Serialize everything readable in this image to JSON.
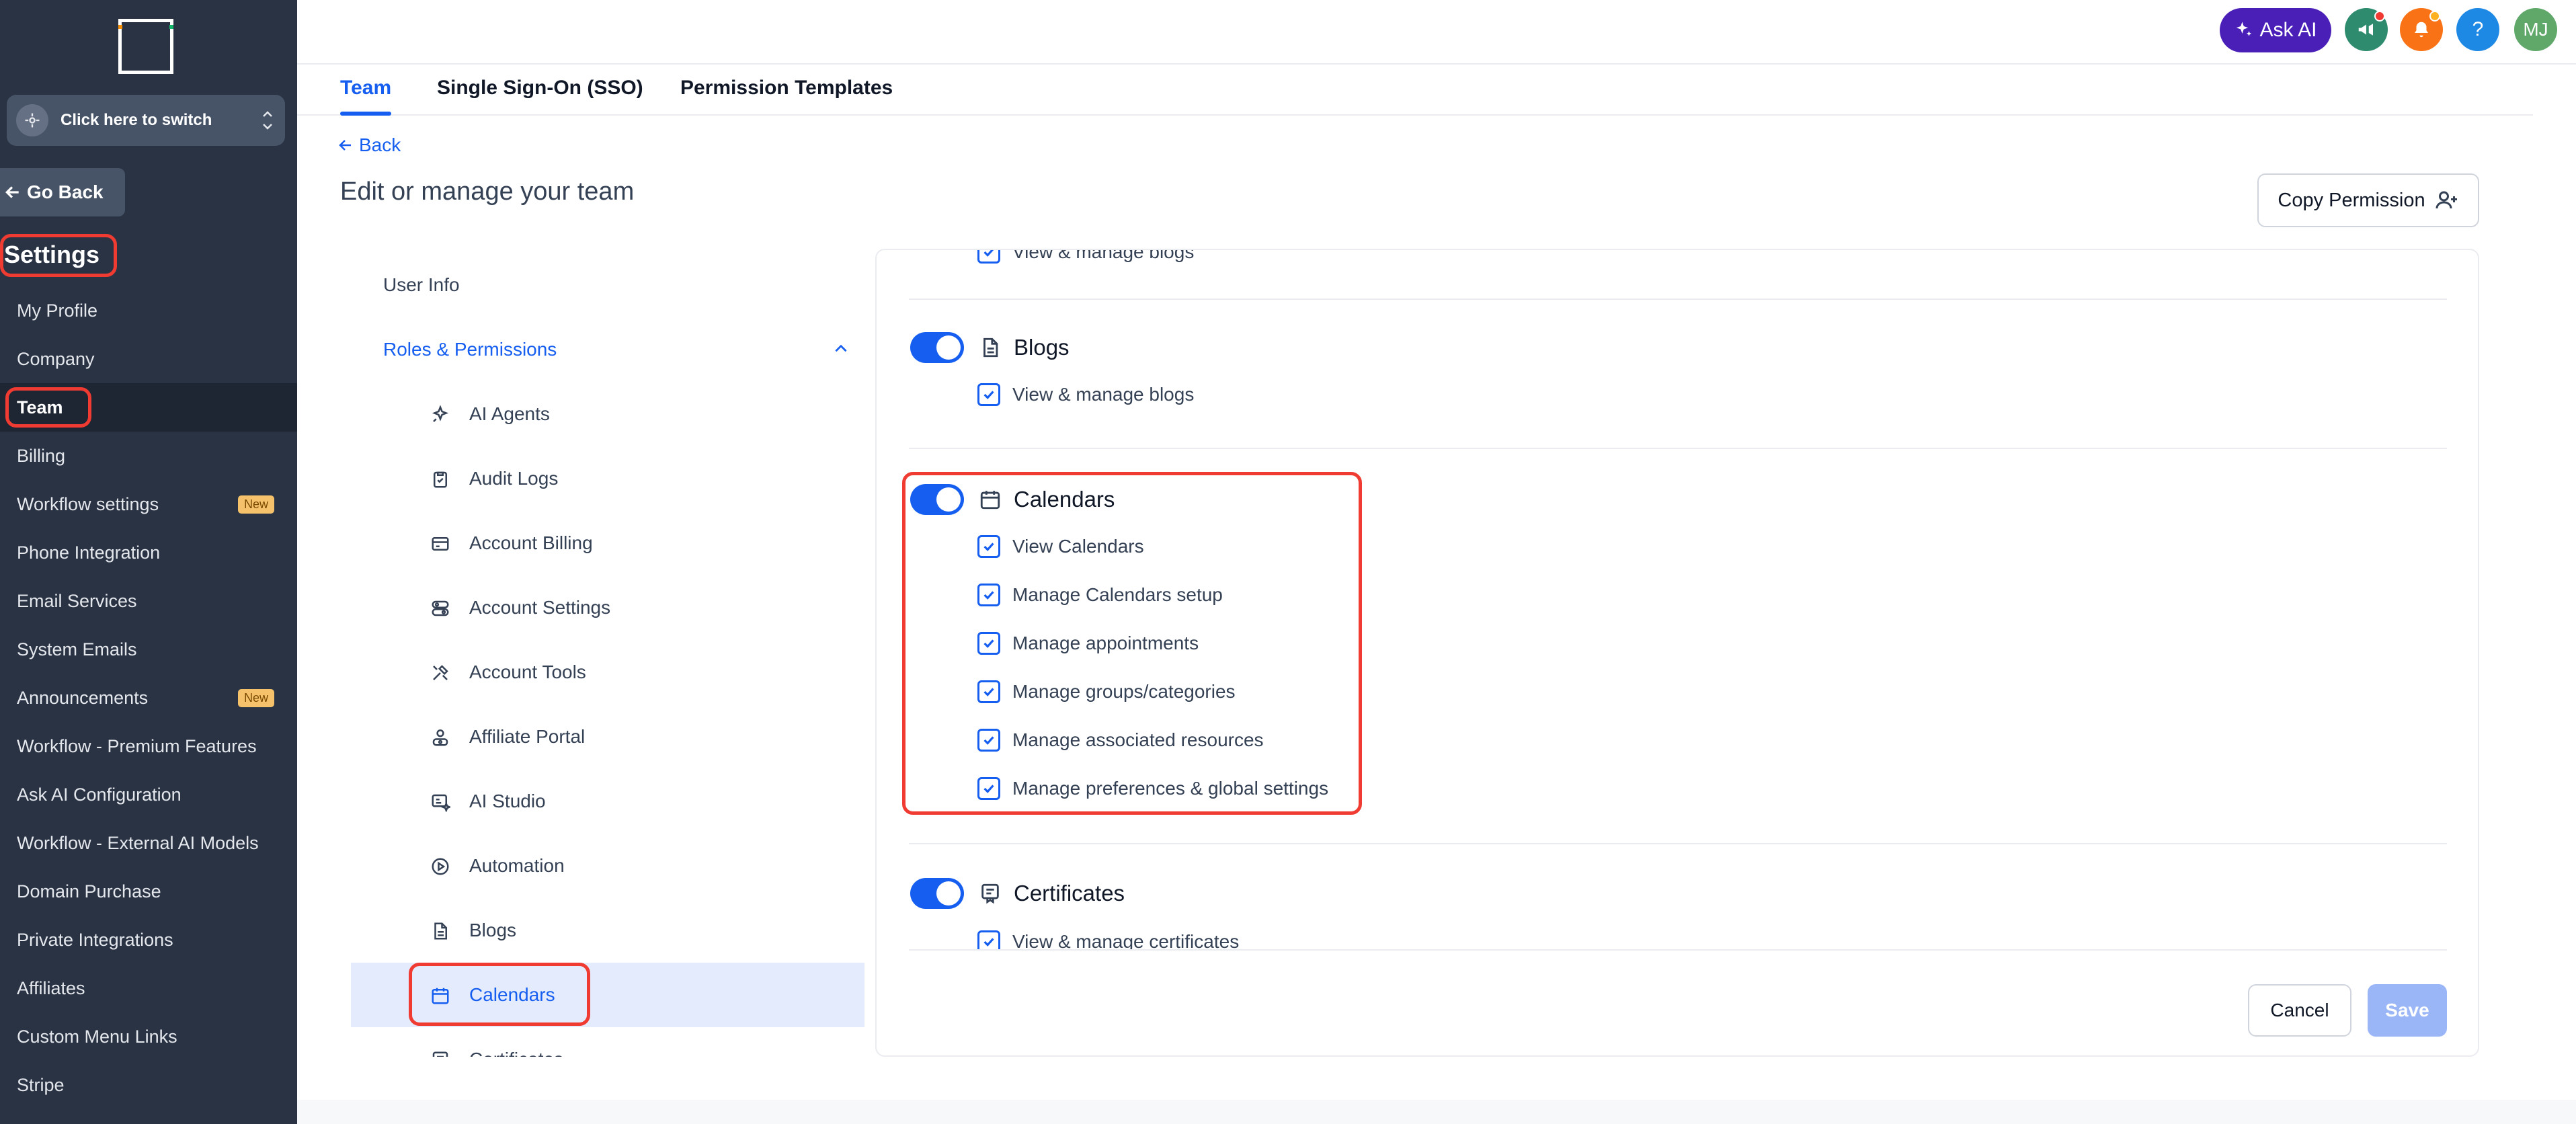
{
  "sidebar": {
    "switcher_label": "Click here to switch",
    "go_back": "Go Back",
    "title": "Settings",
    "items": [
      {
        "label": "My Profile"
      },
      {
        "label": "Company"
      },
      {
        "label": "Team",
        "active": true
      },
      {
        "label": "Billing"
      },
      {
        "label": "Workflow settings",
        "badge": "New"
      },
      {
        "label": "Phone Integration"
      },
      {
        "label": "Email Services"
      },
      {
        "label": "System Emails"
      },
      {
        "label": "Announcements",
        "badge": "New"
      },
      {
        "label": "Workflow - Premium Features"
      },
      {
        "label": "Ask AI Configuration"
      },
      {
        "label": "Workflow - External AI Models"
      },
      {
        "label": "Domain Purchase"
      },
      {
        "label": "Private Integrations"
      },
      {
        "label": "Affiliates"
      },
      {
        "label": "Custom Menu Links"
      },
      {
        "label": "Stripe"
      }
    ]
  },
  "topbar": {
    "ask_ai": "Ask AI",
    "help": "?",
    "avatar_initials": "MJ",
    "colors": {
      "ask_ai": "#4a1fb8",
      "megaphone": "#2e8b6e",
      "bell": "#f97316",
      "help": "#1e88e5",
      "avatar": "#5fa86a"
    }
  },
  "tabs": [
    {
      "label": "Team",
      "active": true
    },
    {
      "label": "Single Sign-On (SSO)"
    },
    {
      "label": "Permission Templates"
    }
  ],
  "back": "Back",
  "page_title": "Edit or manage your team",
  "copy_permission": "Copy Permission",
  "perm_menu": {
    "user_info": "User Info",
    "roles": "Roles & Permissions",
    "items": [
      {
        "label": "AI Agents",
        "icon": "sparkle-icon"
      },
      {
        "label": "Audit Logs",
        "icon": "clipboard-icon"
      },
      {
        "label": "Account Billing",
        "icon": "credit-card-icon"
      },
      {
        "label": "Account Settings",
        "icon": "toggles-icon"
      },
      {
        "label": "Account Tools",
        "icon": "tools-icon"
      },
      {
        "label": "Affiliate Portal",
        "icon": "users-icon"
      },
      {
        "label": "AI Studio",
        "icon": "ai-studio-icon"
      },
      {
        "label": "Automation",
        "icon": "play-circle-icon"
      },
      {
        "label": "Blogs",
        "icon": "file-text-icon"
      },
      {
        "label": "Calendars",
        "icon": "calendar-icon",
        "active": true
      },
      {
        "label": "Certificates",
        "icon": "certificate-icon"
      }
    ]
  },
  "panel": {
    "top_partial": "View & manage blogs",
    "sections": {
      "blogs": {
        "title": "Blogs",
        "permissions": [
          "View & manage blogs"
        ]
      },
      "calendars": {
        "title": "Calendars",
        "permissions": [
          "View Calendars",
          "Manage Calendars setup",
          "Manage appointments",
          "Manage groups/categories",
          "Manage associated resources",
          "Manage preferences & global settings"
        ]
      },
      "certificates": {
        "title": "Certificates",
        "permissions": [
          "View & manage certificates"
        ]
      }
    },
    "cancel": "Cancel",
    "save": "Save"
  }
}
